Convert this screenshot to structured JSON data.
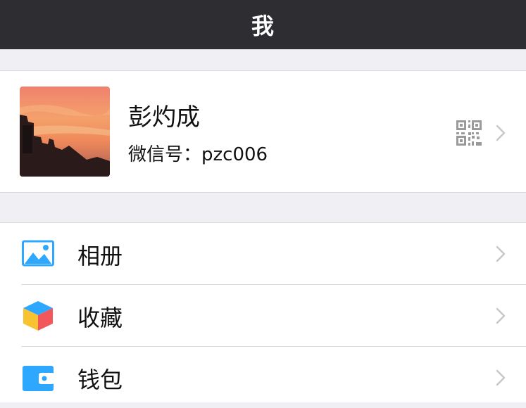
{
  "nav": {
    "title": "我"
  },
  "profile": {
    "name": "彭灼成",
    "wechat_id": "微信号：pzc006",
    "avatar": "sunset-photo",
    "qr_icon": "qr-code-icon",
    "chevron_icon": "chevron-right-icon"
  },
  "menu": {
    "items": [
      {
        "label": "相册",
        "icon": "photo-album-icon",
        "color": "#2ea8ff"
      },
      {
        "label": "收藏",
        "icon": "favorites-cube-icon",
        "color": "#f5a623"
      },
      {
        "label": "钱包",
        "icon": "wallet-icon",
        "color": "#2ea8ff"
      }
    ]
  },
  "colors": {
    "nav_bg": "#2e2e32",
    "page_bg": "#efeff4",
    "card_bg": "#ffffff",
    "divider": "#d9d9d9",
    "chevron": "#c7c7cc"
  }
}
